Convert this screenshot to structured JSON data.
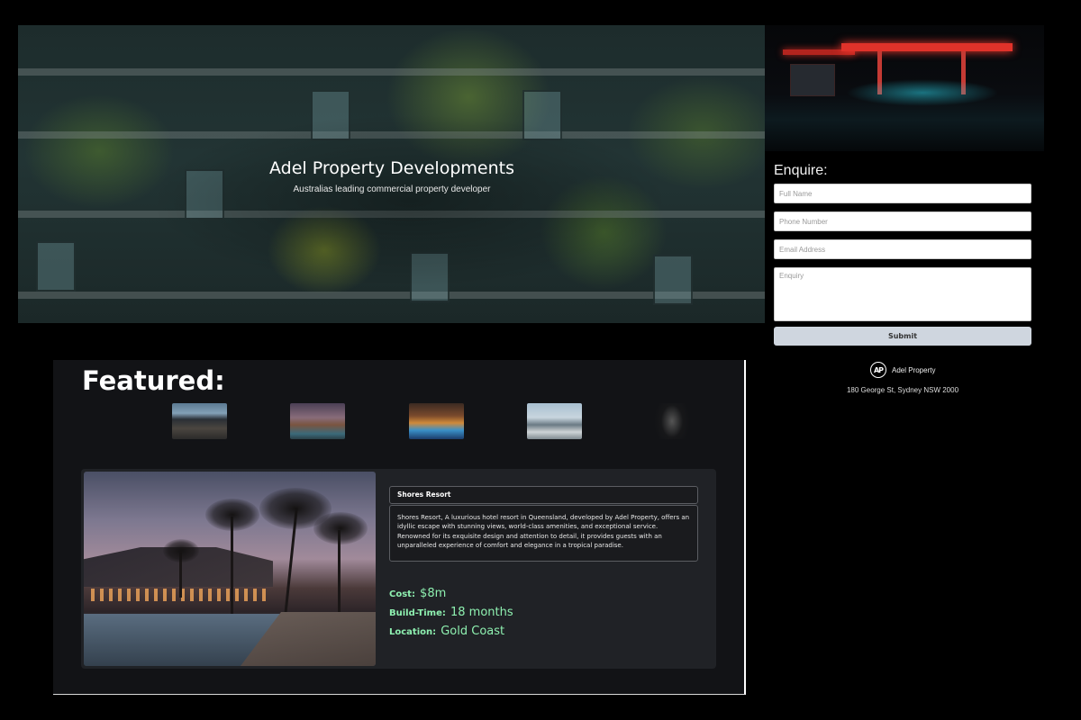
{
  "hero": {
    "title": "Adel Property Developments",
    "subtitle": "Australias leading commercial property developer"
  },
  "enquire": {
    "title": "Enquire:",
    "fields": {
      "full_name": "Full Name",
      "phone": "Phone Number",
      "email": "Email Address",
      "enquiry": "Enquiry"
    },
    "submit_label": "Submit"
  },
  "brand": {
    "logo_text": "AP",
    "name": "Adel Property",
    "address": "180 George St, Sydney NSW 2000"
  },
  "featured": {
    "title": "Featured:",
    "thumbnails": [
      "hotel-exterior-thumb",
      "resort-sunset-thumb",
      "pool-night-thumb",
      "modern-building-thumb",
      "dark-thumb"
    ],
    "selected": {
      "name": "Shores Resort",
      "description": "Shores Resort, A luxurious hotel resort in Queensland, developed by Adel Property, offers an idyllic escape with stunning views, world-class amenities, and exceptional service. Renowned for its exquisite design and attention to detail, it provides guests with an unparalleled experience of comfort and elegance in a tropical paradise.",
      "cost_label": "Cost:",
      "cost_value": "$8m",
      "build_label": "Build-Time:",
      "build_value": "18 months",
      "location_label": "Location:",
      "location_value": "Gold Coast"
    }
  },
  "colors": {
    "background": "#000000",
    "panel": "#121316",
    "card": "#202226",
    "stat_text": "#8ef0b0",
    "submit_bg": "#cfd6df"
  }
}
